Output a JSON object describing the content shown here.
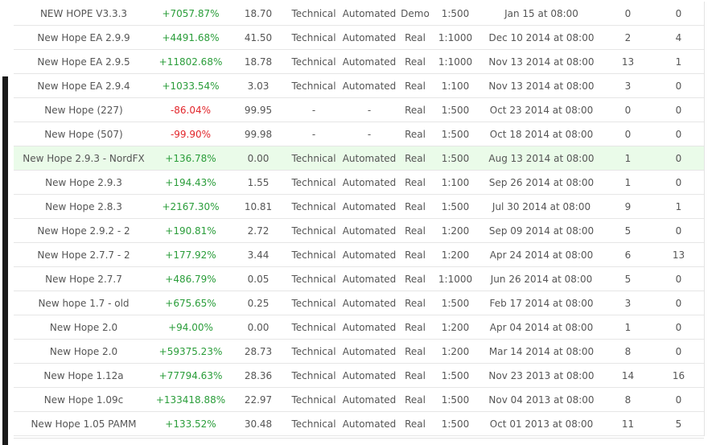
{
  "rows": [
    {
      "name": "NEW HOPE V3.3.3",
      "gain": "+7057.87%",
      "gain_sign": "pos",
      "drawdown": "18.70",
      "analysis": "Technical",
      "method": "Automated",
      "type": "Demo",
      "leverage": "1:500",
      "started": "Jan 15 at 08:00",
      "col_a": "0",
      "col_b": "0"
    },
    {
      "name": "New Hope EA 2.9.9",
      "gain": "+4491.68%",
      "gain_sign": "pos",
      "drawdown": "41.50",
      "analysis": "Technical",
      "method": "Automated",
      "type": "Real",
      "leverage": "1:1000",
      "started": "Dec 10 2014 at 08:00",
      "col_a": "2",
      "col_b": "4"
    },
    {
      "name": "New Hope EA 2.9.5",
      "gain": "+11802.68%",
      "gain_sign": "pos",
      "drawdown": "18.78",
      "analysis": "Technical",
      "method": "Automated",
      "type": "Real",
      "leverage": "1:1000",
      "started": "Nov 13 2014 at 08:00",
      "col_a": "13",
      "col_b": "1"
    },
    {
      "name": "New Hope EA 2.9.4",
      "gain": "+1033.54%",
      "gain_sign": "pos",
      "drawdown": "3.03",
      "analysis": "Technical",
      "method": "Automated",
      "type": "Real",
      "leverage": "1:100",
      "started": "Nov 13 2014 at 08:00",
      "col_a": "3",
      "col_b": "0"
    },
    {
      "name": "New Hope (227)",
      "gain": "-86.04%",
      "gain_sign": "neg",
      "drawdown": "99.95",
      "analysis": "-",
      "method": "-",
      "type": "Real",
      "leverage": "1:500",
      "started": "Oct 23 2014 at 08:00",
      "col_a": "0",
      "col_b": "0"
    },
    {
      "name": "New Hope (507)",
      "gain": "-99.90%",
      "gain_sign": "neg",
      "drawdown": "99.98",
      "analysis": "-",
      "method": "-",
      "type": "Real",
      "leverage": "1:500",
      "started": "Oct 18 2014 at 08:00",
      "col_a": "0",
      "col_b": "0"
    },
    {
      "name": "New Hope 2.9.3 - NordFX",
      "gain": "+136.78%",
      "gain_sign": "pos",
      "drawdown": "0.00",
      "analysis": "Technical",
      "method": "Automated",
      "type": "Real",
      "leverage": "1:500",
      "started": "Aug 13 2014 at 08:00",
      "col_a": "1",
      "col_b": "0",
      "highlight": true
    },
    {
      "name": "New Hope 2.9.3",
      "gain": "+194.43%",
      "gain_sign": "pos",
      "drawdown": "1.55",
      "analysis": "Technical",
      "method": "Automated",
      "type": "Real",
      "leverage": "1:100",
      "started": "Sep 26 2014 at 08:00",
      "col_a": "1",
      "col_b": "0"
    },
    {
      "name": "New Hope 2.8.3",
      "gain": "+2167.30%",
      "gain_sign": "pos",
      "drawdown": "10.81",
      "analysis": "Technical",
      "method": "Automated",
      "type": "Real",
      "leverage": "1:500",
      "started": "Jul 30 2014 at 08:00",
      "col_a": "9",
      "col_b": "1"
    },
    {
      "name": "New Hope 2.9.2 - 2",
      "gain": "+190.81%",
      "gain_sign": "pos",
      "drawdown": "2.72",
      "analysis": "Technical",
      "method": "Automated",
      "type": "Real",
      "leverage": "1:200",
      "started": "Sep 09 2014 at 08:00",
      "col_a": "5",
      "col_b": "0"
    },
    {
      "name": "New Hope 2.7.7 - 2",
      "gain": "+177.92%",
      "gain_sign": "pos",
      "drawdown": "3.44",
      "analysis": "Technical",
      "method": "Automated",
      "type": "Real",
      "leverage": "1:200",
      "started": "Apr 24 2014 at 08:00",
      "col_a": "6",
      "col_b": "13"
    },
    {
      "name": "New Hope 2.7.7",
      "gain": "+486.79%",
      "gain_sign": "pos",
      "drawdown": "0.05",
      "analysis": "Technical",
      "method": "Automated",
      "type": "Real",
      "leverage": "1:1000",
      "started": "Jun 26 2014 at 08:00",
      "col_a": "5",
      "col_b": "0"
    },
    {
      "name": "New hope 1.7 - old",
      "gain": "+675.65%",
      "gain_sign": "pos",
      "drawdown": "0.25",
      "analysis": "Technical",
      "method": "Automated",
      "type": "Real",
      "leverage": "1:500",
      "started": "Feb 17 2014 at 08:00",
      "col_a": "3",
      "col_b": "0"
    },
    {
      "name": "New Hope 2.0",
      "gain": "+94.00%",
      "gain_sign": "pos",
      "drawdown": "0.00",
      "analysis": "Technical",
      "method": "Automated",
      "type": "Real",
      "leverage": "1:200",
      "started": "Apr 04 2014 at 08:00",
      "col_a": "1",
      "col_b": "0"
    },
    {
      "name": "New Hope 2.0",
      "gain": "+59375.23%",
      "gain_sign": "pos",
      "drawdown": "28.73",
      "analysis": "Technical",
      "method": "Automated",
      "type": "Real",
      "leverage": "1:200",
      "started": "Mar 14 2014 at 08:00",
      "col_a": "8",
      "col_b": "0"
    },
    {
      "name": "New Hope 1.12a",
      "gain": "+77794.63%",
      "gain_sign": "pos",
      "drawdown": "28.36",
      "analysis": "Technical",
      "method": "Automated",
      "type": "Real",
      "leverage": "1:500",
      "started": "Nov 23 2013 at 08:00",
      "col_a": "14",
      "col_b": "16"
    },
    {
      "name": "New Hope 1.09c",
      "gain": "+133418.88%",
      "gain_sign": "pos",
      "drawdown": "22.97",
      "analysis": "Technical",
      "method": "Automated",
      "type": "Real",
      "leverage": "1:500",
      "started": "Nov 04 2013 at 08:00",
      "col_a": "8",
      "col_b": "0"
    },
    {
      "name": "New Hope 1.05 PAMM",
      "gain": "+133.52%",
      "gain_sign": "pos",
      "drawdown": "30.48",
      "analysis": "Technical",
      "method": "Automated",
      "type": "Real",
      "leverage": "1:500",
      "started": "Oct 01 2013 at 08:00",
      "col_a": "11",
      "col_b": "5"
    }
  ],
  "colors": {
    "gain_positive": "#2a9d3a",
    "gain_negative": "#e2262b",
    "highlight_row": "#eafbe9",
    "text": "#555555",
    "row_border": "#e6e6e6"
  }
}
